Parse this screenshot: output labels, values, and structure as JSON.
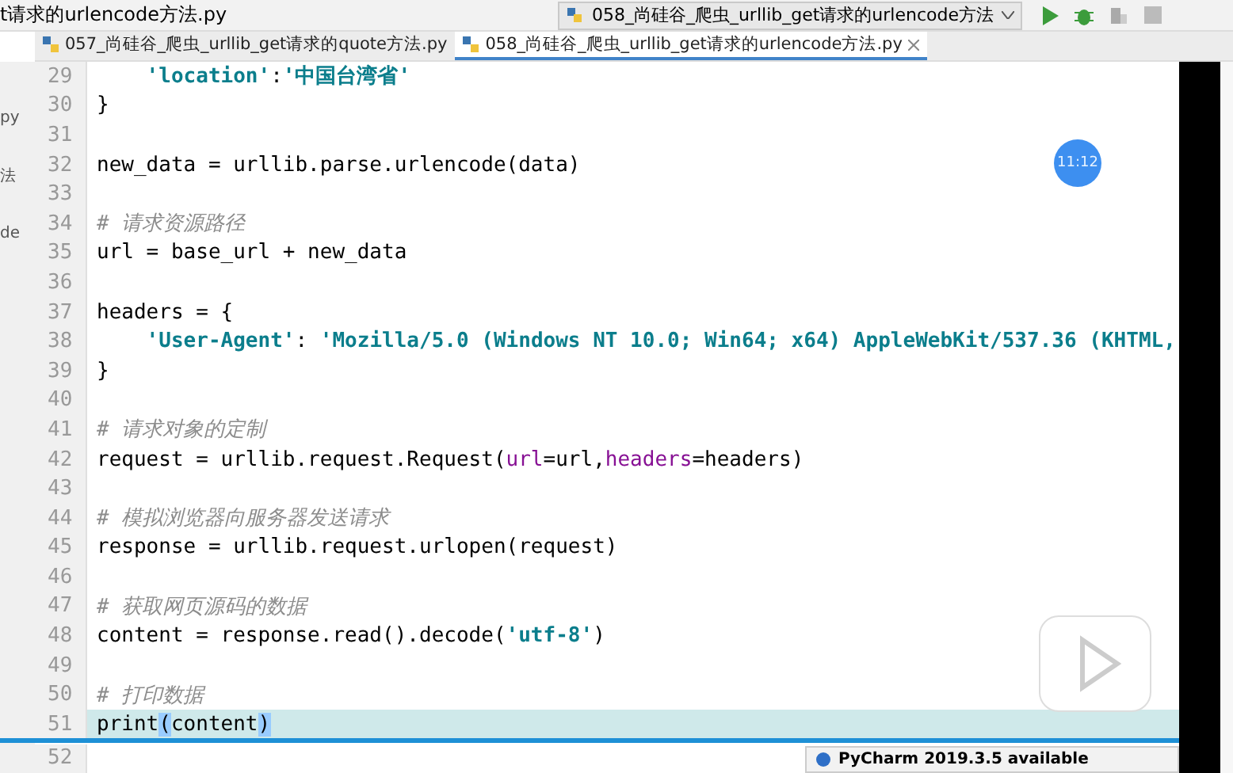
{
  "title_bar": {
    "file_title": "t请求的urlencode方法.py",
    "run_config": "058_尚硅谷_爬虫_urllib_get请求的urlencode方法"
  },
  "side_fragments": [
    "py",
    "法",
    "de"
  ],
  "tabs": [
    {
      "label": "057_尚硅谷_爬虫_urllib_get请求的quote方法.py",
      "selected": false
    },
    {
      "label": "058_尚硅谷_爬虫_urllib_get请求的urlencode方法.py",
      "selected": true
    }
  ],
  "editor": {
    "lines": [
      {
        "number": "29",
        "current": false,
        "tokens": [
          {
            "kind": "string",
            "text": "    'location'"
          },
          {
            "kind": "plain",
            "text": ":"
          },
          {
            "kind": "string",
            "text": "'中国台湾省'"
          }
        ]
      },
      {
        "number": "30",
        "current": false,
        "tokens": [
          {
            "kind": "plain",
            "text": "}"
          }
        ]
      },
      {
        "number": "31",
        "current": false
      },
      {
        "number": "32",
        "current": false,
        "tokens": [
          {
            "kind": "plain",
            "text": "new_data = urllib.parse.urlencode(data)"
          }
        ]
      },
      {
        "number": "33",
        "current": false
      },
      {
        "number": "34",
        "current": false,
        "tokens": [
          {
            "kind": "comment",
            "text": "# 请求资源路径"
          }
        ]
      },
      {
        "number": "35",
        "current": false,
        "tokens": [
          {
            "kind": "plain",
            "text": "url = base_url + new_data"
          }
        ]
      },
      {
        "number": "36",
        "current": false
      },
      {
        "number": "37",
        "current": false,
        "tokens": [
          {
            "kind": "plain",
            "text": "headers = {"
          }
        ]
      },
      {
        "number": "38",
        "current": false,
        "tokens": [
          {
            "kind": "string",
            "text": "    'User-Agent'"
          },
          {
            "kind": "plain",
            "text": ": "
          },
          {
            "kind": "string",
            "text": "'Mozilla/5.0 (Windows NT 10.0; Win64; x64) AppleWebKit/537.36 (KHTML,"
          }
        ]
      },
      {
        "number": "39",
        "current": false,
        "tokens": [
          {
            "kind": "plain",
            "text": "}"
          }
        ]
      },
      {
        "number": "40",
        "current": false
      },
      {
        "number": "41",
        "current": false,
        "tokens": [
          {
            "kind": "comment",
            "text": "# 请求对象的定制"
          }
        ]
      },
      {
        "number": "42",
        "current": false,
        "tokens": [
          {
            "kind": "plain",
            "text": "request = urllib.request.Request("
          },
          {
            "kind": "param",
            "text": "url"
          },
          {
            "kind": "plain",
            "text": "=url,"
          },
          {
            "kind": "param",
            "text": "headers"
          },
          {
            "kind": "plain",
            "text": "=headers)"
          }
        ]
      },
      {
        "number": "43",
        "current": false
      },
      {
        "number": "44",
        "current": false,
        "tokens": [
          {
            "kind": "comment",
            "text": "# 模拟浏览器向服务器发送请求"
          }
        ]
      },
      {
        "number": "45",
        "current": false,
        "tokens": [
          {
            "kind": "plain",
            "text": "response = urllib.request.urlopen(request)"
          }
        ]
      },
      {
        "number": "46",
        "current": false
      },
      {
        "number": "47",
        "current": false,
        "tokens": [
          {
            "kind": "comment",
            "text": "# 获取网页源码的数据"
          }
        ]
      },
      {
        "number": "48",
        "current": false,
        "tokens": [
          {
            "kind": "plain",
            "text": "content = response.read().decode("
          },
          {
            "kind": "string",
            "text": "'utf-8'"
          },
          {
            "kind": "plain",
            "text": ")"
          }
        ]
      },
      {
        "number": "49",
        "current": false
      },
      {
        "number": "50",
        "current": false,
        "tokens": [
          {
            "kind": "comment",
            "text": "# 打印数据"
          }
        ]
      },
      {
        "number": "51",
        "current": true,
        "tokens": [
          {
            "kind": "plain",
            "text": "print"
          },
          {
            "kind": "bracket",
            "text": "("
          },
          {
            "kind": "plain",
            "text": "content"
          },
          {
            "kind": "bracket",
            "text": ")"
          }
        ]
      },
      {
        "number": "52",
        "current": false
      }
    ]
  },
  "video_overlay": {
    "time": "11:12",
    "level": 0.956
  },
  "notification": {
    "text": "PyCharm 2019.3.5 available"
  }
}
